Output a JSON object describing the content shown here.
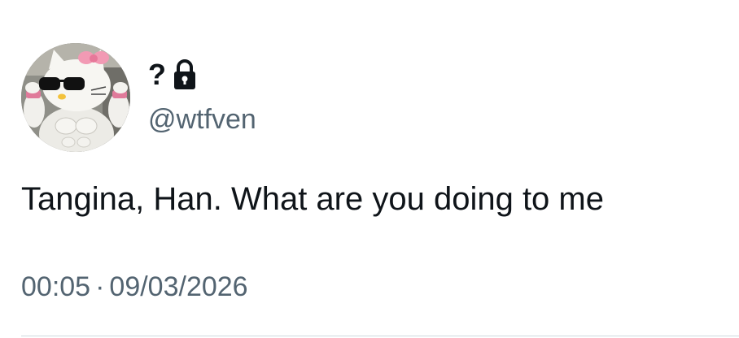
{
  "tweet": {
    "author": {
      "display_name": "?",
      "handle": "@wtfven",
      "protected_icon": "lock-icon",
      "avatar_icon": "hello-kitty-avatar"
    },
    "text": "Tangina, Han. What are you doing to me",
    "time": "00:05",
    "separator": "·",
    "date": "09/03/2026"
  },
  "colors": {
    "text_primary": "#0f1419",
    "text_secondary": "#536471",
    "divider": "#cfd9de",
    "background": "#ffffff"
  }
}
